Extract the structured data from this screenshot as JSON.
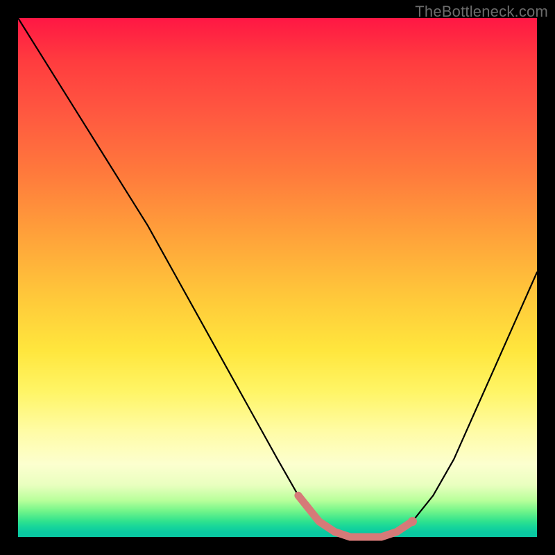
{
  "watermark": "TheBottleneck.com",
  "colors": {
    "curve": "#000000",
    "highlight": "#d67a78",
    "background_top": "#ff1744",
    "background_bottom": "#09c7a2"
  },
  "chart_data": {
    "type": "line",
    "title": "",
    "xlabel": "",
    "ylabel": "",
    "xlim": [
      0,
      100
    ],
    "ylim": [
      0,
      100
    ],
    "grid": false,
    "legend": false,
    "series": [
      {
        "name": "bottleneck-curve",
        "x": [
          0,
          5,
          10,
          15,
          20,
          25,
          30,
          35,
          40,
          45,
          50,
          54,
          58,
          61,
          64,
          67,
          70,
          73,
          76,
          80,
          84,
          88,
          92,
          96,
          100
        ],
        "y": [
          100,
          92,
          84,
          76,
          68,
          60,
          51,
          42,
          33,
          24,
          15,
          8,
          3,
          1,
          0,
          0,
          0,
          1,
          3,
          8,
          15,
          24,
          33,
          42,
          51
        ]
      }
    ],
    "highlight_segment": {
      "name": "optimal-range",
      "x": [
        54,
        58,
        61,
        64,
        67,
        70,
        73,
        76
      ],
      "y": [
        8,
        3,
        1,
        0,
        0,
        0,
        1,
        3
      ]
    }
  }
}
